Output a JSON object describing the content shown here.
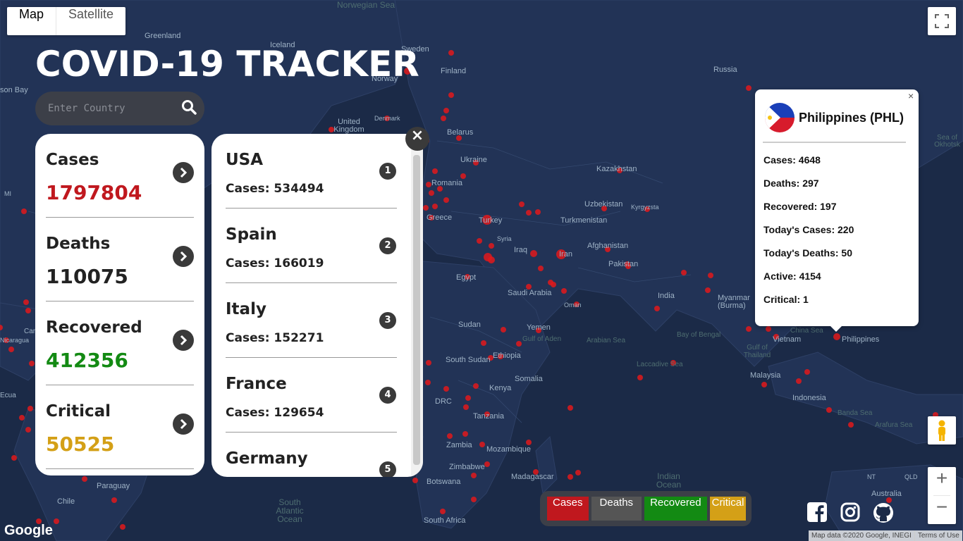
{
  "map": {
    "type_buttons": [
      "Map",
      "Satellite"
    ],
    "active_type": "Map",
    "labels": {
      "norwegian_sea": "Norwegian Sea",
      "greenland": "Greenland",
      "iceland": "Iceland",
      "sweden": "Sweden",
      "finland": "Finland",
      "norway": "Norway",
      "russia": "Russia",
      "son_bay": "son Bay",
      "denmark": "Denmark",
      "united_kingdom": "United Kingdom",
      "belarus": "Belarus",
      "ukraine": "Ukraine",
      "kazakhstan": "Kazakhstan",
      "sea_of_okhotsk": "Sea of Okhotsk",
      "romania": "Romania",
      "uzbekistan": "Uzbekistan",
      "kyrgyzstan": "Kyrgyzsta",
      "turkey": "Turkey",
      "turkmenistan": "Turkmenistan",
      "greece": "Greece",
      "syria": "Syria",
      "iraq": "Iraq",
      "iran": "Iran",
      "afghanistan": "Afghanistan",
      "pakistan": "Pakistan",
      "egypt": "Egypt",
      "saudi_arabia": "Saudi Arabia",
      "oman": "Oman",
      "india": "India",
      "myanmar": "Myanmar (Burma)",
      "sudan": "Sudan",
      "yemen": "Yemen",
      "gulf_of_aden": "Gulf of Aden",
      "arabian_sea": "Arabian Sea",
      "bay_of_bengal": "Bay of Bengal",
      "china_sea": "China Sea",
      "vietnam": "Vietnam",
      "philippines": "Philippines",
      "gulf_of_thailand": "Gulf of Thailand",
      "south_sudan": "South Sudan",
      "ethiopia": "Ethiopia",
      "somalia": "Somalia",
      "laccadive_sea": "Laccadive Sea",
      "malaysia": "Malaysia",
      "kenya": "Kenya",
      "drc": "DRC",
      "tanzania": "Tanzania",
      "indonesia": "Indonesia",
      "banda_sea": "Banda Sea",
      "arafura_sea": "Arafura Sea",
      "zambia": "Zambia",
      "mozambique": "Mozambique",
      "zimbabwe": "Zimbabwe",
      "madagascar": "Madagascar",
      "botswana": "Botswana",
      "indian_ocean": "Indian\nOcean",
      "paraguay": "Paraguay",
      "chile": "Chile",
      "south_atlantic": "South\nAtlantic\nOcean",
      "south_africa": "South Africa",
      "australia": "Australia",
      "nt": "NT",
      "qld": "QLD",
      "ecu": "Ecua",
      "car": "Car",
      "nicaragua": "Nicaragua",
      "mi": "MI"
    },
    "attribution": [
      "Map data ©2020 Google, INEGI",
      "Terms of Use"
    ],
    "logo": "Google",
    "marker_color": "#e0191b"
  },
  "app": {
    "title": "COVID-19 TRACKER",
    "search_placeholder": "Enter Country"
  },
  "stats": [
    {
      "label": "Cases",
      "value": "1797804",
      "color": "#c0181e"
    },
    {
      "label": "Deaths",
      "value": "110075",
      "color": "#222222"
    },
    {
      "label": "Recovered",
      "value": "412356",
      "color": "#138a13"
    },
    {
      "label": "Critical",
      "value": "50525",
      "color": "#d4a017"
    }
  ],
  "countries": [
    {
      "name": "USA",
      "cases": "Cases: 534494",
      "rank": "1"
    },
    {
      "name": "Spain",
      "cases": "Cases: 166019",
      "rank": "2"
    },
    {
      "name": "Italy",
      "cases": "Cases: 152271",
      "rank": "3"
    },
    {
      "name": "France",
      "cases": "Cases: 129654",
      "rank": "4"
    },
    {
      "name": "Germany",
      "cases": "",
      "rank": "5"
    }
  ],
  "popup": {
    "close": "×",
    "name": "Philippines (PHL)",
    "lines": [
      "Cases: 4648",
      "Deaths: 297",
      "Recovered: 197",
      "Today's Cases: 220",
      "Today's Deaths: 50",
      "Active: 4154",
      "Critical: 1"
    ]
  },
  "filters": [
    {
      "label": "Cases",
      "color": "#c0181e"
    },
    {
      "label": "Deaths",
      "color": "#555555"
    },
    {
      "label": "Recovered",
      "color": "#138a13"
    },
    {
      "label": "Critical",
      "color": "#d4a017"
    }
  ],
  "icons": {
    "search": "search-icon",
    "close": "close-icon",
    "fullscreen": "fullscreen-icon",
    "pegman": "pegman-icon",
    "facebook": "facebook-icon",
    "instagram": "instagram-icon",
    "github": "github-icon"
  },
  "zoom": {
    "in": "+",
    "out": "−"
  }
}
